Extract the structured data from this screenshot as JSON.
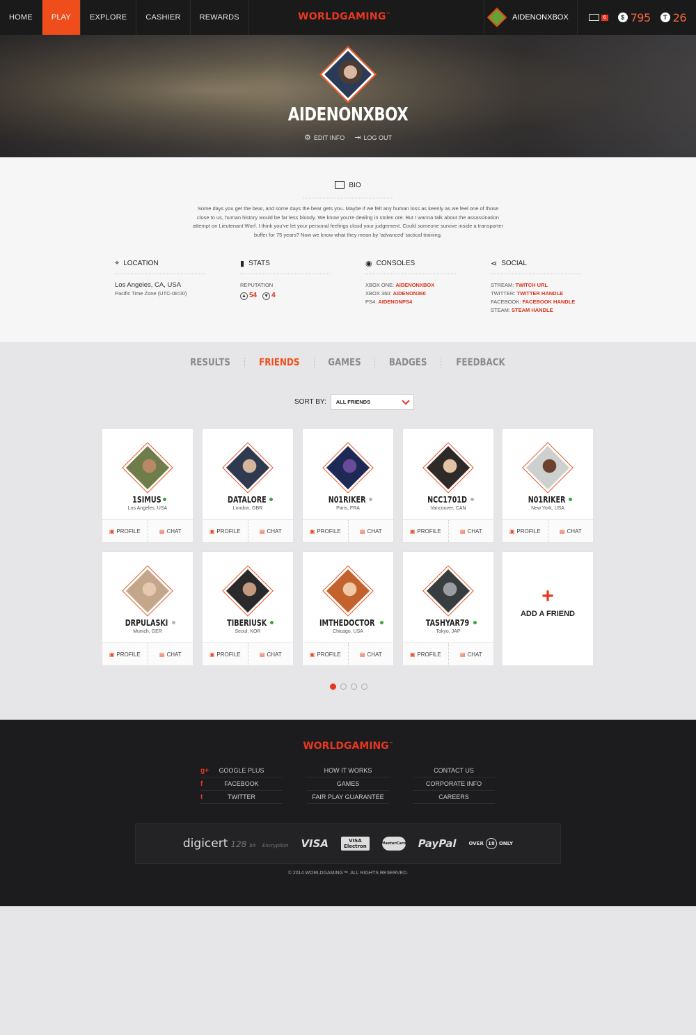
{
  "nav": {
    "items": [
      {
        "label": "HOME",
        "active": false
      },
      {
        "label": "PLAY",
        "active": true
      },
      {
        "label": "EXPLORE",
        "active": false
      },
      {
        "label": "CASHIER",
        "active": false
      },
      {
        "label": "REWARDS",
        "active": false
      }
    ],
    "brand": "WORLDGAMING",
    "brand_mark": "™",
    "username": "AIDENONXBOX",
    "mail_count": "6",
    "cash_icon": "$",
    "cash": "795",
    "tokens_icon": "T",
    "tokens": "26"
  },
  "hero": {
    "name": "AIDENONXBOX",
    "edit_label": "EDIT INFO",
    "logout_label": "LOG OUT"
  },
  "bio": {
    "heading": "BIO",
    "text": "Some days you get the bear, and some days the bear gets you. Maybe if we felt any human loss as keenly as we feel one of those close to us, human history would be far less bloody. We know you're dealing in stolen ore. But I wanna talk about the assassination attempt on Lieutenant Worf. I think you've let your personal feelings cloud your judgement. Could someone survive inside a transporter buffer for 75 years? Now we know what they mean by 'advanced' tactical training."
  },
  "location": {
    "heading": "LOCATION",
    "city": "Los Angeles, CA, USA",
    "timezone": "Pacific Time Zone (UTC-08:00)"
  },
  "stats": {
    "heading": "STATS",
    "rep_label": "REPUTATION",
    "rep_up": "54",
    "rep_down": "4"
  },
  "consoles": {
    "heading": "CONSOLES",
    "rows": [
      {
        "label": "XBOX ONE:",
        "value": "AIDENONXBOX"
      },
      {
        "label": "XBOX 360:",
        "value": "AIDENON360"
      },
      {
        "label": "PS4:",
        "value": "AIDENONPS4"
      }
    ]
  },
  "social": {
    "heading": "SOCIAL",
    "rows": [
      {
        "label": "STREAM:",
        "value": "TWITCH URL"
      },
      {
        "label": "TWITTER:",
        "value": "TWITTER HANDLE"
      },
      {
        "label": "FACEBOOK:",
        "value": "FACEBOOK HANDLE"
      },
      {
        "label": "STEAM:",
        "value": "STEAM HANDLE"
      }
    ]
  },
  "tabs": [
    {
      "label": "RESULTS",
      "active": false
    },
    {
      "label": "FRIENDS",
      "active": true
    },
    {
      "label": "GAMES",
      "active": false
    },
    {
      "label": "BADGES",
      "active": false
    },
    {
      "label": "FEEDBACK",
      "active": false
    }
  ],
  "sort": {
    "label": "SORT BY:",
    "value": "ALL FRIENDS"
  },
  "friends": [
    {
      "name": "1SIMUS",
      "location": "Los Angeles, USA",
      "online": true,
      "skin": "#b98866",
      "bg": "#6f7d4a"
    },
    {
      "name": "DATALORE",
      "location": "London, GBR",
      "online": true,
      "skin": "#d5b59c",
      "bg": "#2f3a4f"
    },
    {
      "name": "N01RIKER",
      "location": "Paris, FRA",
      "online": false,
      "skin": "#6a4b9a",
      "bg": "#1e2a55"
    },
    {
      "name": "NCC1701D",
      "location": "Vancouver, CAN",
      "online": false,
      "skin": "#e2c3a5",
      "bg": "#2e2a28"
    },
    {
      "name": "N01RIKER",
      "location": "New York, USA",
      "online": true,
      "skin": "#6b4230",
      "bg": "#cdd0cf"
    },
    {
      "name": "DRPULASKI",
      "location": "Munich, GER",
      "online": false,
      "skin": "#e5c8ad",
      "bg": "#c4a68a"
    },
    {
      "name": "TIBERIUSK",
      "location": "Seoul, KOR",
      "online": true,
      "skin": "#c49a7e",
      "bg": "#2b2a2a"
    },
    {
      "name": "IMTHEDOCTOR",
      "location": "Chicago, USA",
      "online": true,
      "skin": "#f0c9a7",
      "bg": "#c4622d"
    },
    {
      "name": "TASHYAR79",
      "location": "Tokyo, JAP",
      "online": true,
      "skin": "#9a9ea0",
      "bg": "#3a3d3f"
    }
  ],
  "card_actions": {
    "profile": "PROFILE",
    "chat": "CHAT"
  },
  "add_friend": {
    "plus": "+",
    "label": "ADD A FRIEND"
  },
  "pager": {
    "pages": 4,
    "current": 1
  },
  "footer": {
    "brand": "WORLDGAMING",
    "brand_mark": "™",
    "social": [
      {
        "icon": "g+",
        "label": "GOOGLE PLUS"
      },
      {
        "icon": "f",
        "label": "FACEBOOK"
      },
      {
        "icon": "t",
        "label": "TWITTER"
      }
    ],
    "links_mid": [
      "HOW IT WORKS",
      "GAMES",
      "FAIR PLAY GUARANTEE"
    ],
    "links_right": [
      "CONTACT US",
      "CORPORATE INFO",
      "CAREERS"
    ],
    "payments": {
      "digicert": "digicert",
      "bits": "128",
      "bit_label": "bit",
      "encryption": "Encryption",
      "visa": "VISA",
      "visa_electron_top": "VISA",
      "visa_electron_bottom": "Electron",
      "mastercard": "MasterCard",
      "paypal": "PayPal",
      "over": "OVER",
      "age": "18",
      "only": "ONLY"
    },
    "copyright": "© 2014 WORLDGAMING™. ALL RIGHTS RESERVED."
  },
  "colors": {
    "accent": "#ef4e1c",
    "online": "#3aa53a",
    "offline": "#b5b5b5",
    "footer_bg": "#1c1c1e"
  }
}
